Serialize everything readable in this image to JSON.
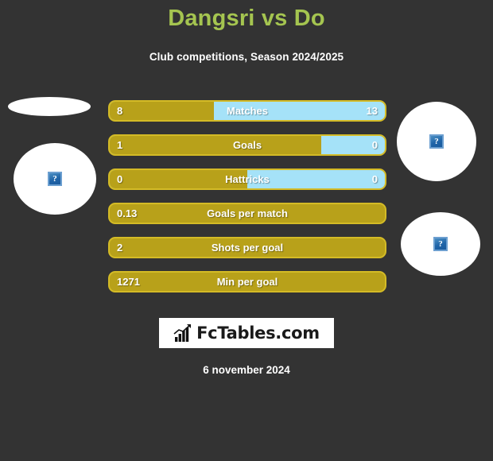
{
  "header": {
    "title": "Dangsri vs Do",
    "subtitle": "Club competitions, Season 2024/2025",
    "title_color": "#a5c550"
  },
  "theme": {
    "background": "#333333",
    "home_color": "#b8a11a",
    "away_color": "#a5e2f8",
    "bar_border": "#d4bb26",
    "text_color": "#ffffff"
  },
  "avatars": [
    {
      "name": "home-avatar-top",
      "placeholder": "?",
      "has_icon": false
    },
    {
      "name": "home-avatar-bottom",
      "placeholder": "?",
      "has_icon": true
    },
    {
      "name": "away-avatar-top",
      "placeholder": "?",
      "has_icon": true
    },
    {
      "name": "away-avatar-bottom",
      "placeholder": "?",
      "has_icon": true
    }
  ],
  "chart_data": {
    "type": "bar",
    "title": "Dangsri vs Do",
    "subtitle": "Club competitions, Season 2024/2025",
    "orientation": "horizontal-diverging",
    "categories": [
      "Matches",
      "Goals",
      "Hattricks",
      "Goals per match",
      "Shots per goal",
      "Min per goal"
    ],
    "series": [
      {
        "name": "Dangsri",
        "color": "#b8a11a",
        "values": [
          "8",
          "1",
          "0",
          "0.13",
          "2",
          "1271"
        ]
      },
      {
        "name": "Do",
        "color": "#a5e2f8",
        "values": [
          "13",
          "0",
          "0",
          null,
          null,
          null
        ]
      }
    ],
    "rows": [
      {
        "label": "Matches",
        "home": "8",
        "away": "13",
        "home_pct": 38,
        "two_sided": true
      },
      {
        "label": "Goals",
        "home": "1",
        "away": "0",
        "home_pct": 77,
        "two_sided": true
      },
      {
        "label": "Hattricks",
        "home": "0",
        "away": "0",
        "home_pct": 50,
        "two_sided": true
      },
      {
        "label": "Goals per match",
        "home": "0.13",
        "away": "",
        "home_pct": 100,
        "two_sided": false
      },
      {
        "label": "Shots per goal",
        "home": "2",
        "away": "",
        "home_pct": 100,
        "two_sided": false
      },
      {
        "label": "Min per goal",
        "home": "1271",
        "away": "",
        "home_pct": 100,
        "two_sided": false
      }
    ],
    "xlabel": "",
    "ylabel": "",
    "grid": false,
    "legend": "none"
  },
  "logo": {
    "text": "FcTables.com",
    "icon": "bar-chart-icon"
  },
  "footer": {
    "date": "6 november 2024"
  }
}
